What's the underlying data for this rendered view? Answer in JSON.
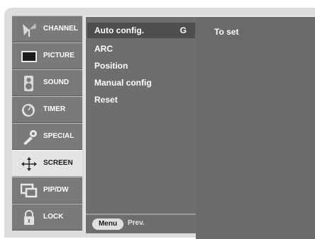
{
  "left_menu": {
    "items": [
      {
        "label": "CHANNEL",
        "icon": "antenna-icon",
        "active": false
      },
      {
        "label": "PICTURE",
        "icon": "tv-screen-icon",
        "active": false
      },
      {
        "label": "SOUND",
        "icon": "speaker-icon",
        "active": false
      },
      {
        "label": "TIMER",
        "icon": "clock-icon",
        "active": false
      },
      {
        "label": "SPECIAL",
        "icon": "special-tool-icon",
        "active": false
      },
      {
        "label": "SCREEN",
        "icon": "move-arrows-icon",
        "active": true
      },
      {
        "label": "PIP/DW",
        "icon": "pip-windows-icon",
        "active": false
      },
      {
        "label": "LOCK",
        "icon": "padlock-icon",
        "active": false
      }
    ]
  },
  "submenu": {
    "items": [
      {
        "label": "Auto config.",
        "key": "G",
        "selected": true
      },
      {
        "label": "ARC",
        "key": "",
        "selected": false
      },
      {
        "label": "Position",
        "key": "",
        "selected": false
      },
      {
        "label": "Manual config",
        "key": "",
        "selected": false
      },
      {
        "label": "Reset",
        "key": "",
        "selected": false
      }
    ],
    "footer": {
      "menu_label": "Menu",
      "prev_label": "Prev."
    }
  },
  "right_panel": {
    "text": "To set"
  },
  "colors": {
    "frame": "#dcdcdc",
    "menu_bg": "#7a7a7a",
    "menu_active_bg": "#e4e4e4",
    "submenu_bg": "#6e6e6e",
    "submenu_selected_bg": "#4e4e4e",
    "panel_bg": "#6a6a6a"
  }
}
